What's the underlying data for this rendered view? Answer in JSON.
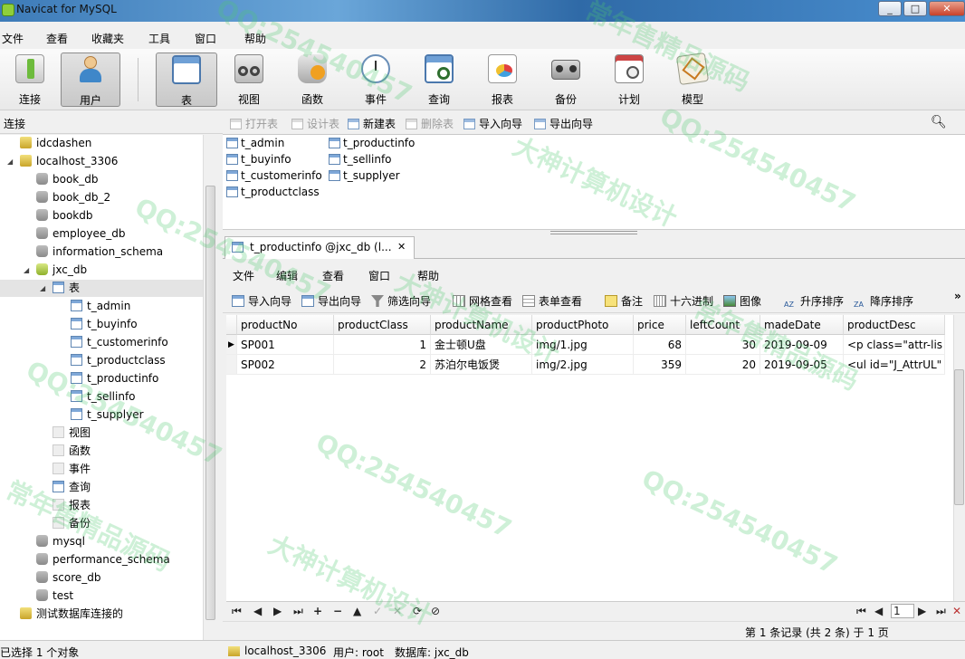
{
  "window": {
    "title": "Navicat for MySQL",
    "min": "_",
    "max": "□",
    "close": "✕"
  },
  "menu": [
    "文件",
    "查看",
    "收藏夹",
    "工具",
    "窗口",
    "帮助"
  ],
  "toolbar": {
    "connect": "连接",
    "user": "用户",
    "table": "表",
    "view": "视图",
    "function": "函数",
    "event": "事件",
    "query": "查询",
    "report": "报表",
    "backup": "备份",
    "schedule": "计划",
    "model": "模型"
  },
  "left": {
    "header": "连接",
    "tree": [
      {
        "label": "idcdashen",
        "level": 1,
        "icon": "connection-icon"
      },
      {
        "label": "localhost_3306",
        "level": 1,
        "icon": "connection-icon",
        "expanded": true
      },
      {
        "label": "book_db",
        "level": 2,
        "icon": "database-icon"
      },
      {
        "label": "book_db_2",
        "level": 2,
        "icon": "database-icon"
      },
      {
        "label": "bookdb",
        "level": 2,
        "icon": "database-icon"
      },
      {
        "label": "employee_db",
        "level": 2,
        "icon": "database-icon"
      },
      {
        "label": "information_schema",
        "level": 2,
        "icon": "database-icon"
      },
      {
        "label": "jxc_db",
        "level": 2,
        "icon": "database-open-icon",
        "expanded": true
      },
      {
        "label": "表",
        "level": 3,
        "icon": "table-folder-icon",
        "expanded": true,
        "selected": true
      },
      {
        "label": "t_admin",
        "level": 4,
        "icon": "table-icon"
      },
      {
        "label": "t_buyinfo",
        "level": 4,
        "icon": "table-icon"
      },
      {
        "label": "t_customerinfo",
        "level": 4,
        "icon": "table-icon"
      },
      {
        "label": "t_productclass",
        "level": 4,
        "icon": "table-icon"
      },
      {
        "label": "t_productinfo",
        "level": 4,
        "icon": "table-icon"
      },
      {
        "label": "t_sellinfo",
        "level": 4,
        "icon": "table-icon"
      },
      {
        "label": "t_supplyer",
        "level": 4,
        "icon": "table-icon"
      },
      {
        "label": "视图",
        "level": 3,
        "icon": "view-icon"
      },
      {
        "label": "函数",
        "level": 3,
        "icon": "function-icon"
      },
      {
        "label": "事件",
        "level": 3,
        "icon": "event-icon"
      },
      {
        "label": "查询",
        "level": 3,
        "icon": "query-icon"
      },
      {
        "label": "报表",
        "level": 3,
        "icon": "report-icon"
      },
      {
        "label": "备份",
        "level": 3,
        "icon": "backup-icon"
      },
      {
        "label": "mysql",
        "level": 2,
        "icon": "database-icon"
      },
      {
        "label": "performance_schema",
        "level": 2,
        "icon": "database-icon"
      },
      {
        "label": "score_db",
        "level": 2,
        "icon": "database-icon"
      },
      {
        "label": "test",
        "level": 2,
        "icon": "database-icon"
      },
      {
        "label": "测试数据库连接的",
        "level": 1,
        "icon": "connection-icon"
      }
    ]
  },
  "objbar": {
    "open": "打开表",
    "design": "设计表",
    "new": "新建表",
    "delete": "删除表",
    "import": "导入向导",
    "export": "导出向导"
  },
  "tables": [
    "t_admin",
    "t_buyinfo",
    "t_customerinfo",
    "t_productclass",
    "t_productinfo",
    "t_sellinfo",
    "t_supplyer"
  ],
  "tab": {
    "label": "t_productinfo @jxc_db (l...",
    "close": "✕"
  },
  "innermenu": [
    "文件",
    "编辑",
    "查看",
    "窗口",
    "帮助"
  ],
  "innertb": {
    "import": "导入向导",
    "export": "导出向导",
    "filter": "筛选向导",
    "gridview": "网格查看",
    "formview": "表单查看",
    "memo": "备注",
    "hex": "十六进制",
    "image": "图像",
    "sortasc": "升序排序",
    "sortdesc": "降序排序",
    "more": "»"
  },
  "grid": {
    "columns": [
      "productNo",
      "productClass",
      "productName",
      "productPhoto",
      "price",
      "leftCount",
      "madeDate",
      "productDesc"
    ],
    "rows": [
      [
        "SP001",
        "1",
        "金士顿U盘",
        "img/1.jpg",
        "68",
        "30",
        "2019-09-09",
        "<p class=\"attr-lis"
      ],
      [
        "SP002",
        "2",
        "苏泊尔电饭煲",
        "img/2.jpg",
        "359",
        "20",
        "2019-09-05",
        "<ul id=\"J_AttrUL\""
      ]
    ]
  },
  "nav": {
    "first": "⏮",
    "prev": "◀",
    "next": "▶",
    "last": "⏭",
    "add": "+",
    "remove": "−",
    "up": "▲",
    "apply": "✓",
    "cancel": "✕",
    "refresh": "⟳",
    "stop": "⊘",
    "page": "1"
  },
  "recordinfo": "第 1 条记录 (共 2 条) 于 1 页",
  "status": {
    "selection": "已选择 1 个对象",
    "connection": "localhost_3306",
    "user": "用户: root",
    "database": "数据库: jxc_db"
  },
  "watermarks": [
    "QQ:254540457",
    "常年售精品源码",
    "大神计算机设计"
  ]
}
